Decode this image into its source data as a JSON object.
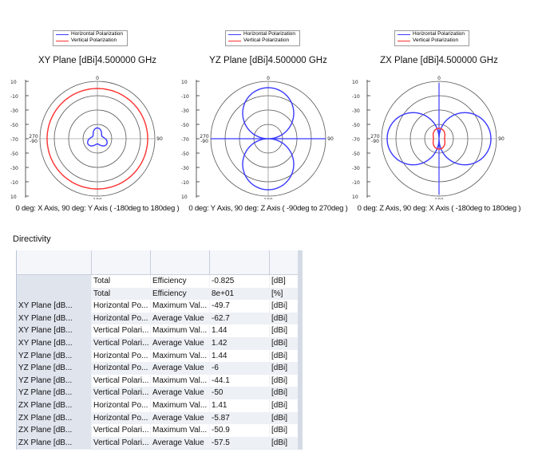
{
  "legend": {
    "horizontal": "Horizontal Polarization",
    "vertical": "Vertical Polarization",
    "h_color": "#3a3aff",
    "v_color": "#ff3030"
  },
  "panels": [
    {
      "title": "XY Plane [dBi]4.500000 GHz",
      "caption": "0 deg: X Axis, 90 deg: Y Axis ( -180deg to 180deg )"
    },
    {
      "title": "YZ Plane [dBi]4.500000 GHz",
      "caption": "0 deg: Y Axis, 90 deg: Z Axis ( -90deg to 270deg )"
    },
    {
      "title": "ZX Plane [dBi]4.500000 GHz",
      "caption": "0 deg: Z Axis, 90 deg: X Axis ( -180deg to 180deg )"
    }
  ],
  "polar_ticks": {
    "radial": [
      "10",
      "-10",
      "-30",
      "-50",
      "-70",
      "-50",
      "-30",
      "-10",
      "10"
    ],
    "top": "0",
    "right": "90",
    "left": "270",
    "left2": "-90",
    "bottom": "180"
  },
  "directivity": {
    "title": "Directivity",
    "rows": [
      [
        "",
        "Total",
        "Efficiency",
        "-0.825",
        "[dB]"
      ],
      [
        "",
        "Total",
        "Efficiency",
        "8e+01",
        "[%]"
      ],
      [
        "XY Plane [dB...",
        "Horizontal Po...",
        "Maximum Val...",
        "-49.7",
        "[dBi]"
      ],
      [
        "XY Plane [dB...",
        "Horizontal Po...",
        "Average Value",
        "-62.7",
        "[dBi]"
      ],
      [
        "XY Plane [dB...",
        "Vertical Polari...",
        "Maximum Val...",
        "1.44",
        "[dBi]"
      ],
      [
        "XY Plane [dB...",
        "Vertical Polari...",
        "Average Value",
        "1.42",
        "[dBi]"
      ],
      [
        "YZ Plane [dB...",
        "Horizontal Po...",
        "Maximum Val...",
        "1.44",
        "[dBi]"
      ],
      [
        "YZ Plane [dB...",
        "Horizontal Po...",
        "Average Value",
        "-6",
        "[dBi]"
      ],
      [
        "YZ Plane [dB...",
        "Vertical Polari...",
        "Maximum Val...",
        "-44.1",
        "[dBi]"
      ],
      [
        "YZ Plane [dB...",
        "Vertical Polari...",
        "Average Value",
        "-50",
        "[dBi]"
      ],
      [
        "ZX Plane [dB...",
        "Horizontal Po...",
        "Maximum Val...",
        "1.41",
        "[dBi]"
      ],
      [
        "ZX Plane [dB...",
        "Horizontal Po...",
        "Average Value",
        "-5.87",
        "[dBi]"
      ],
      [
        "ZX Plane [dB...",
        "Vertical Polari...",
        "Maximum Val...",
        "-50.9",
        "[dBi]"
      ],
      [
        "ZX Plane [dB...",
        "Vertical Polari...",
        "Average Value",
        "-57.5",
        "[dBi]"
      ]
    ]
  }
}
